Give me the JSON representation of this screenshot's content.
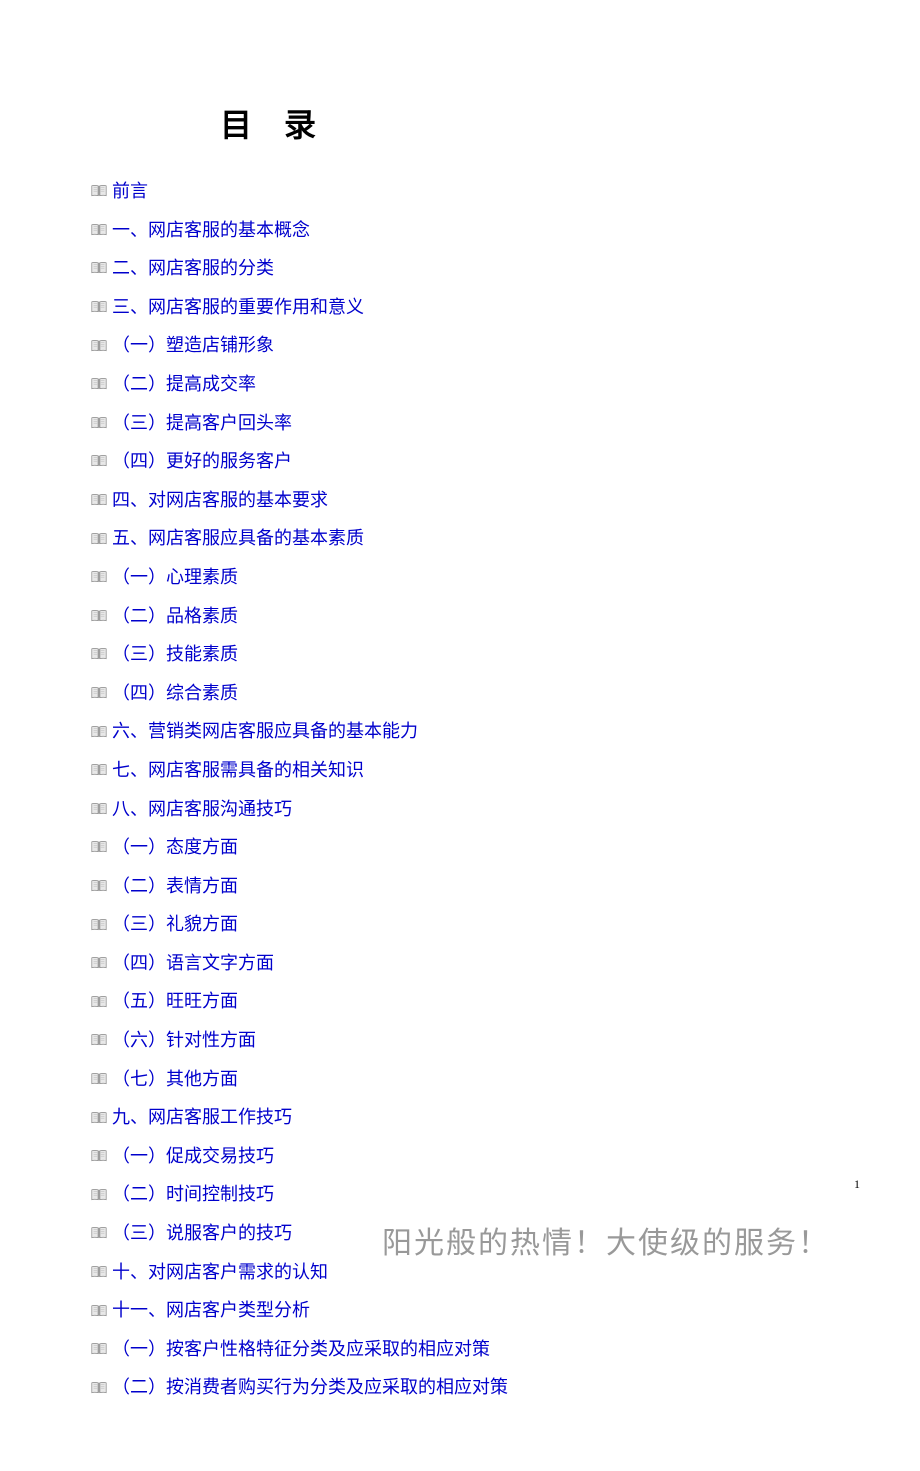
{
  "title": "目 录",
  "toc": [
    {
      "label": "前言",
      "indent": false
    },
    {
      "label": "一、网店客服的基本概念",
      "indent": false
    },
    {
      "label": "二、网店客服的分类",
      "indent": false
    },
    {
      "label": "三、网店客服的重要作用和意义",
      "indent": false
    },
    {
      "label": "（一）塑造店铺形象",
      "indent": true
    },
    {
      "label": "（二）提高成交率",
      "indent": true
    },
    {
      "label": "（三）提高客户回头率",
      "indent": true
    },
    {
      "label": "（四）更好的服务客户",
      "indent": true
    },
    {
      "label": "四、对网店客服的基本要求",
      "indent": false
    },
    {
      "label": "五、网店客服应具备的基本素质",
      "indent": false
    },
    {
      "label": "（一）心理素质",
      "indent": true
    },
    {
      "label": "（二）品格素质",
      "indent": true
    },
    {
      "label": "（三）技能素质",
      "indent": true
    },
    {
      "label": "（四）综合素质",
      "indent": true
    },
    {
      "label": "六、营销类网店客服应具备的基本能力",
      "indent": false
    },
    {
      "label": "七、网店客服需具备的相关知识",
      "indent": false
    },
    {
      "label": "八、网店客服沟通技巧",
      "indent": false
    },
    {
      "label": "（一）态度方面",
      "indent": true
    },
    {
      "label": "（二）表情方面",
      "indent": true
    },
    {
      "label": "（三）礼貌方面",
      "indent": true
    },
    {
      "label": "（四）语言文字方面",
      "indent": true
    },
    {
      "label": "（五）旺旺方面",
      "indent": true
    },
    {
      "label": "（六）针对性方面",
      "indent": true
    },
    {
      "label": "（七）其他方面",
      "indent": true
    },
    {
      "label": "九、网店客服工作技巧",
      "indent": false
    },
    {
      "label": "（一）促成交易技巧",
      "indent": true
    },
    {
      "label": "（二）时间控制技巧",
      "indent": true
    },
    {
      "label": "（三）说服客户的技巧",
      "indent": true
    },
    {
      "label": "十、对网店客户需求的认知",
      "indent": false
    },
    {
      "label": "十一、网店客户类型分析",
      "indent": false
    },
    {
      "label": "（一）按客户性格特征分类及应采取的相应对策",
      "indent": true
    },
    {
      "label": "（二）按消费者购买行为分类及应采取的相应对策",
      "indent": true
    }
  ],
  "footer": "阳光般的热情！大使级的服务！",
  "pageNumber": "1"
}
